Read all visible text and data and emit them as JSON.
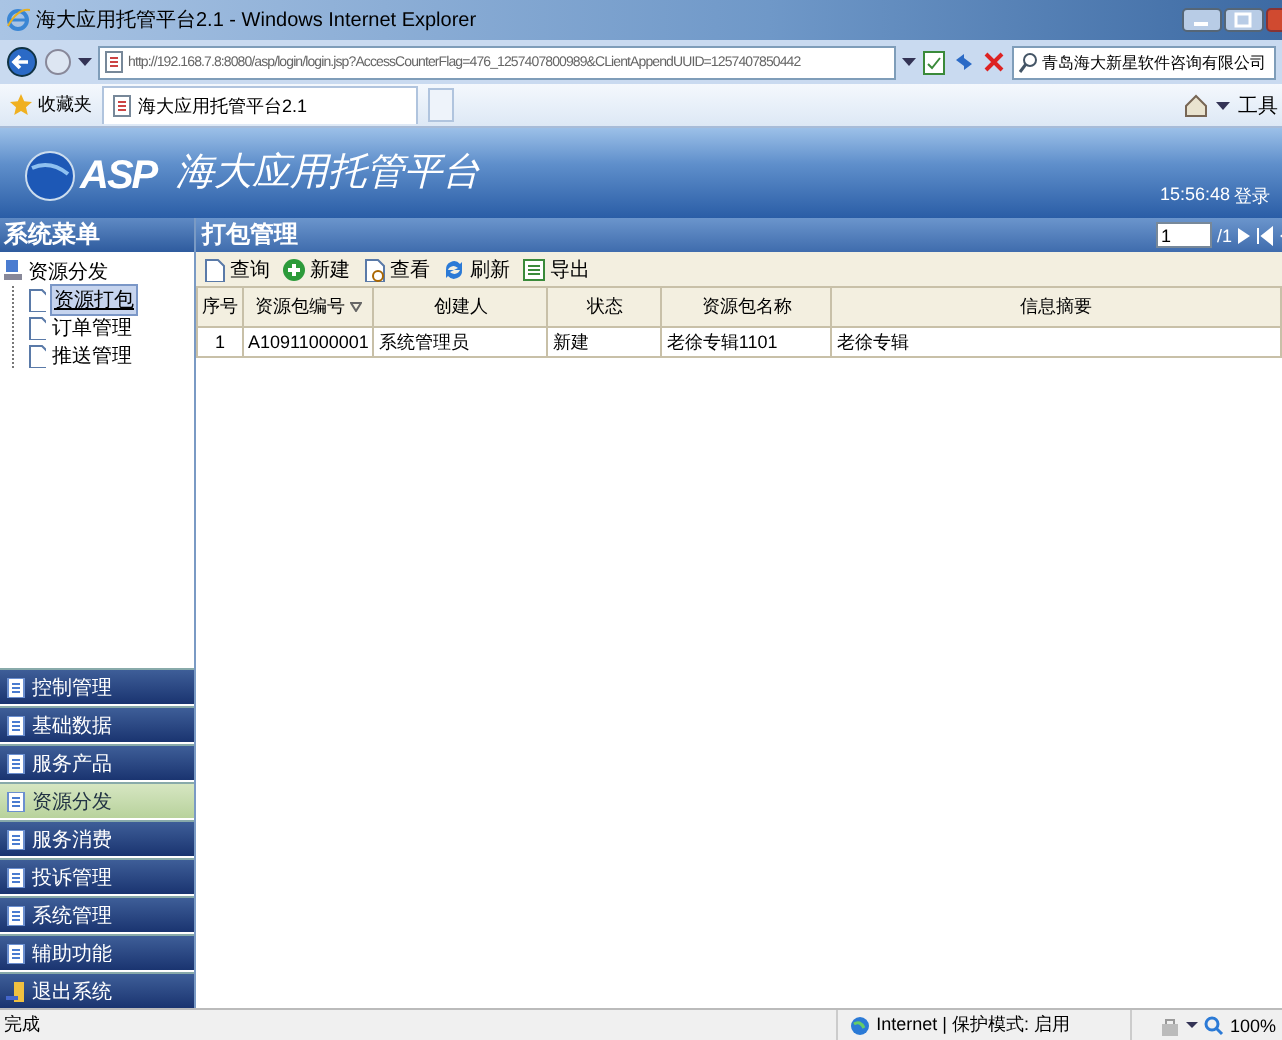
{
  "window": {
    "title": "海大应用托管平台2.1 - Windows Internet Explorer"
  },
  "address_bar": {
    "url": "http://192.168.7.8:8080/asp/login/login.jsp?AccessCounterFlag=476_1257407800989&CLientAppendUUID=1257407850442"
  },
  "search": {
    "value": "青岛海大新星软件咨询有限公司"
  },
  "favorites_bar": {
    "favorites": "收藏夹",
    "tab": "海大应用托管平台2.1",
    "tools": "工具"
  },
  "banner": {
    "logo": "ASP",
    "title": "海大应用托管平台",
    "time": "15:56:48",
    "login": "登录"
  },
  "sidebar": {
    "title": "系统菜单",
    "tree": [
      {
        "label": "资源分发",
        "expanded": true,
        "children": [
          {
            "label": "资源打包",
            "selected": true
          },
          {
            "label": "订单管理",
            "selected": false
          },
          {
            "label": "推送管理",
            "selected": false
          }
        ]
      }
    ],
    "nav": [
      {
        "label": "控制管理",
        "selected": false,
        "kind": "module"
      },
      {
        "label": "基础数据",
        "selected": false,
        "kind": "module"
      },
      {
        "label": "服务产品",
        "selected": false,
        "kind": "module"
      },
      {
        "label": "资源分发",
        "selected": true,
        "kind": "module"
      },
      {
        "label": "服务消费",
        "selected": false,
        "kind": "module"
      },
      {
        "label": "投诉管理",
        "selected": false,
        "kind": "module"
      },
      {
        "label": "系统管理",
        "selected": false,
        "kind": "module"
      },
      {
        "label": "辅助功能",
        "selected": false,
        "kind": "module"
      },
      {
        "label": "退出系统",
        "selected": false,
        "kind": "exit"
      }
    ]
  },
  "content": {
    "title": "打包管理",
    "pager": {
      "page": "1",
      "total": "/1"
    },
    "toolbar": [
      {
        "label": "查询",
        "kind": "query"
      },
      {
        "label": "新建",
        "kind": "new"
      },
      {
        "label": "查看",
        "kind": "view"
      },
      {
        "label": "刷新",
        "kind": "refresh"
      },
      {
        "label": "导出",
        "kind": "export"
      }
    ],
    "table": {
      "columns": [
        {
          "label": "序号",
          "sorted": false
        },
        {
          "label": "资源包编号",
          "sorted": true
        },
        {
          "label": "创建人",
          "sorted": false
        },
        {
          "label": "状态",
          "sorted": false
        },
        {
          "label": "资源包名称",
          "sorted": false
        },
        {
          "label": "信息摘要",
          "sorted": false
        }
      ],
      "rows": [
        [
          "1",
          "A10911000001",
          "系统管理员",
          "新建",
          "老徐专辑1101",
          "老徐专辑"
        ]
      ]
    }
  },
  "status_bar": {
    "text": "完成",
    "zone": "Internet | 保护模式: 启用",
    "zoom": "100%"
  }
}
